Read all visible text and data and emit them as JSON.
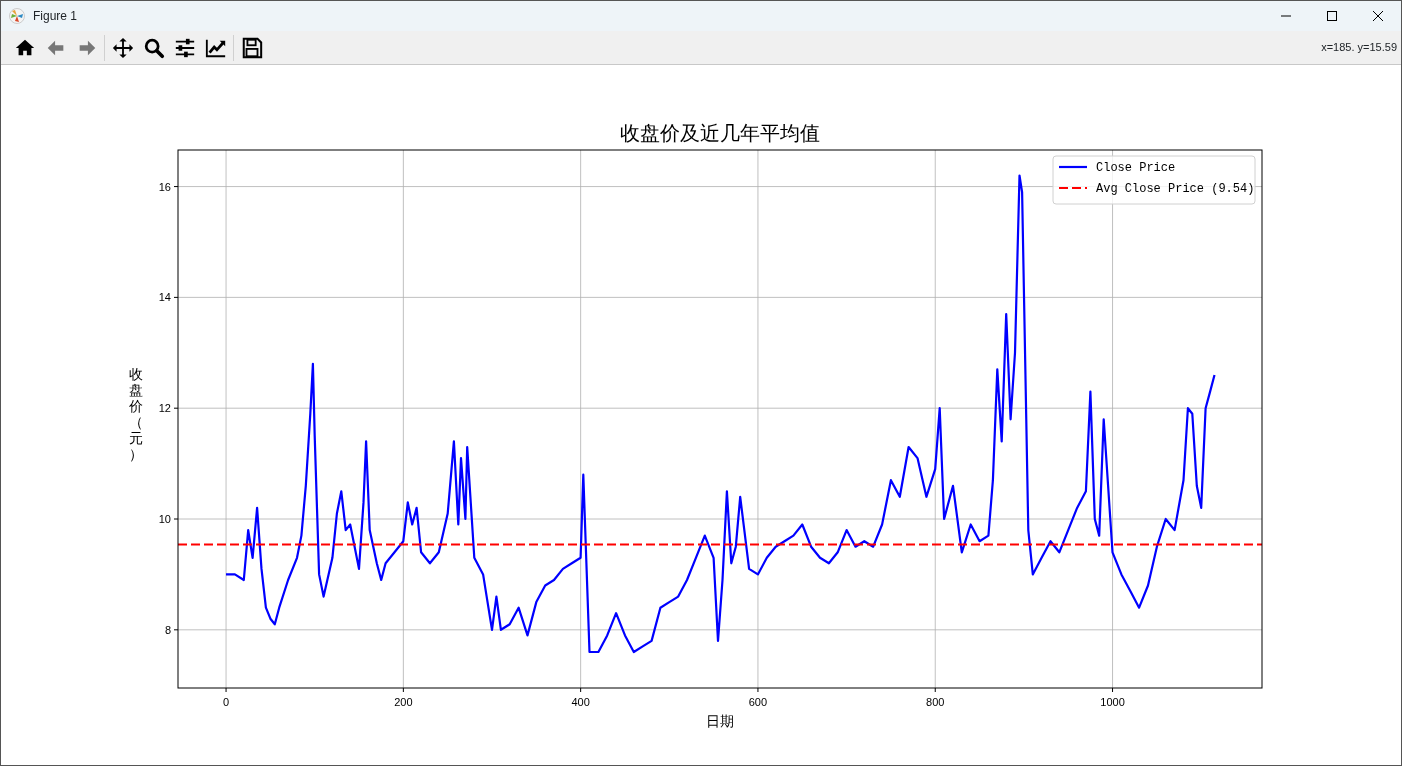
{
  "window": {
    "title": "Figure 1"
  },
  "toolbar": [
    {
      "kind": "home",
      "disabled": false
    },
    {
      "kind": "back",
      "disabled": true
    },
    {
      "kind": "forward",
      "disabled": true
    },
    {
      "kind": "separator"
    },
    {
      "kind": "pan",
      "disabled": false
    },
    {
      "kind": "zoom",
      "disabled": false
    },
    {
      "kind": "subplots",
      "disabled": false
    },
    {
      "kind": "edit",
      "disabled": false
    },
    {
      "kind": "separator"
    },
    {
      "kind": "save",
      "disabled": false
    }
  ],
  "coordinates": "x=185. y=15.59",
  "figure": {
    "chart_data": {
      "type": "line",
      "title": "收盘价及近几年平均值",
      "xlabel": "日期",
      "ylabel": "收盘价（元）",
      "x": [
        0,
        10,
        20,
        25,
        30,
        35,
        40,
        45,
        50,
        55,
        60,
        70,
        80,
        85,
        90,
        95,
        98,
        100,
        105,
        110,
        120,
        125,
        130,
        135,
        140,
        150,
        155,
        158,
        162,
        170,
        175,
        180,
        190,
        200,
        205,
        210,
        215,
        220,
        230,
        240,
        250,
        257,
        262,
        265,
        270,
        272,
        280,
        290,
        300,
        305,
        310,
        320,
        330,
        340,
        350,
        360,
        370,
        380,
        390,
        400,
        403,
        410,
        420,
        430,
        440,
        450,
        460,
        470,
        480,
        490,
        500,
        510,
        520,
        530,
        540,
        550,
        555,
        560,
        565,
        570,
        575,
        580,
        590,
        600,
        610,
        620,
        630,
        640,
        650,
        660,
        670,
        680,
        690,
        700,
        710,
        720,
        730,
        740,
        750,
        760,
        770,
        780,
        790,
        800,
        805,
        810,
        820,
        830,
        840,
        850,
        860,
        865,
        870,
        875,
        880,
        885,
        890,
        895,
        898,
        905,
        910,
        920,
        930,
        940,
        950,
        960,
        970,
        975,
        980,
        985,
        990,
        995,
        1000,
        1010,
        1020,
        1030,
        1040,
        1050,
        1060,
        1070,
        1080,
        1085,
        1090,
        1095,
        1100,
        1105,
        1110,
        1115
      ],
      "series": [
        {
          "name": "Close Price",
          "color": "#0000ff",
          "values": [
            9.0,
            9.0,
            8.9,
            9.8,
            9.3,
            10.2,
            9.1,
            8.4,
            8.2,
            8.1,
            8.4,
            8.9,
            9.3,
            9.7,
            10.6,
            11.9,
            12.8,
            11.5,
            9.0,
            8.6,
            9.3,
            10.1,
            10.5,
            9.8,
            9.9,
            9.1,
            10.3,
            11.4,
            9.8,
            9.2,
            8.9,
            9.2,
            9.4,
            9.6,
            10.3,
            9.9,
            10.2,
            9.4,
            9.2,
            9.4,
            10.1,
            11.4,
            9.9,
            11.1,
            10.0,
            11.3,
            9.3,
            9.0,
            8.0,
            8.6,
            8.0,
            8.1,
            8.4,
            7.9,
            8.5,
            8.8,
            8.9,
            9.1,
            9.2,
            9.3,
            10.8,
            7.6,
            7.6,
            7.9,
            8.3,
            7.9,
            7.6,
            7.7,
            7.8,
            8.4,
            8.5,
            8.6,
            8.9,
            9.3,
            9.7,
            9.3,
            7.8,
            8.9,
            10.5,
            9.2,
            9.5,
            10.4,
            9.1,
            9.0,
            9.3,
            9.5,
            9.6,
            9.7,
            9.9,
            9.5,
            9.3,
            9.2,
            9.4,
            9.8,
            9.5,
            9.6,
            9.5,
            9.9,
            10.7,
            10.4,
            11.3,
            11.1,
            10.4,
            10.9,
            12.0,
            10.0,
            10.6,
            9.4,
            9.9,
            9.6,
            9.7,
            10.7,
            12.7,
            11.4,
            13.7,
            11.8,
            13.0,
            16.2,
            15.9,
            9.8,
            9.0,
            9.3,
            9.6,
            9.4,
            9.8,
            10.2,
            10.5,
            12.3,
            10.0,
            9.7,
            11.8,
            10.6,
            9.4,
            9.0,
            8.7,
            8.4,
            8.8,
            9.5,
            10.0,
            9.8,
            10.7,
            12.0,
            11.9,
            10.6,
            10.2,
            12.0,
            12.3,
            12.6
          ]
        }
      ],
      "ref_lines": [
        {
          "axis": "y",
          "value": 9.54,
          "label": "Avg Close Price (9.54)",
          "color": "#ff0000"
        }
      ],
      "grid": true,
      "legend": true,
      "xlim": [
        -54.2,
        1168.6
      ],
      "ylim": [
        6.95,
        16.66
      ],
      "xticks": [
        0,
        200,
        400,
        600,
        800,
        1000
      ],
      "yticks": [
        8,
        10,
        12,
        14,
        16
      ]
    }
  }
}
